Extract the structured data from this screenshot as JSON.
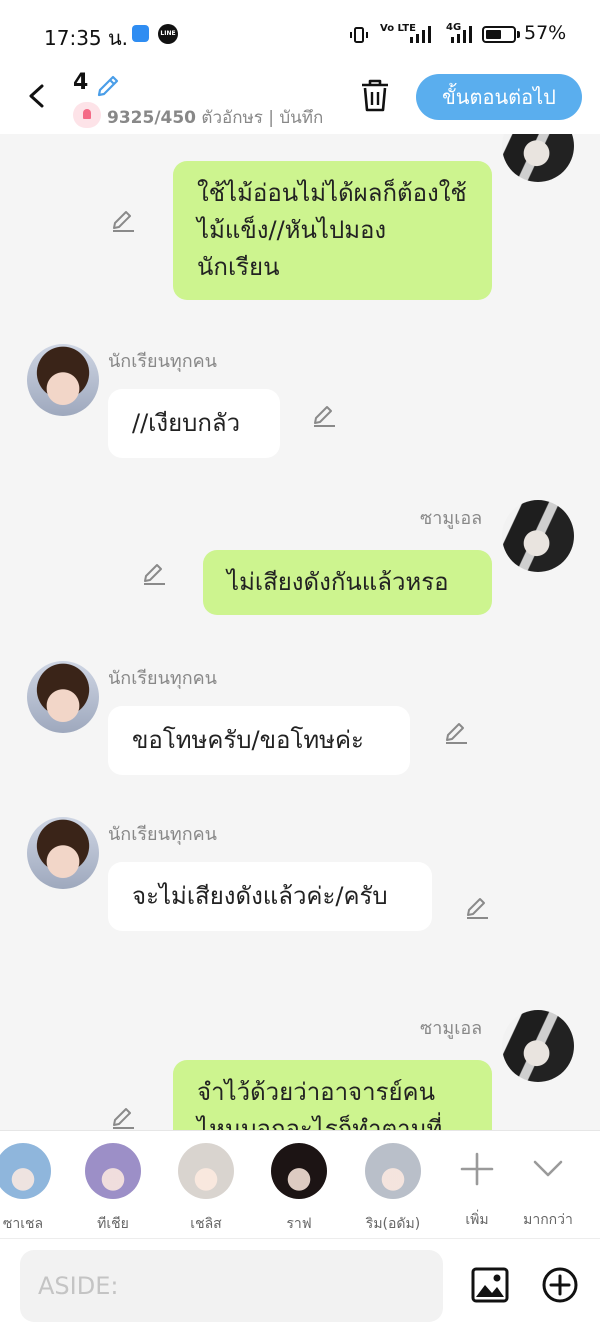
{
  "status_bar": {
    "time": "17:35 น.",
    "line_label": "LINE",
    "volte": "Vo LTE",
    "network": "4G",
    "battery_percent": "57%",
    "battery_level": 0.57
  },
  "header": {
    "episode_number": "4",
    "char_count": "9325/450",
    "char_count_suffix": "ตัวอักษร | บันทึก",
    "next_label": "ขั้นตอนต่อไป"
  },
  "messages": [
    {
      "side": "right",
      "text": "ใช้ไม้อ่อนไม่ได้ผลก็ต้องใช้ไม้แข็ง//หันไปมองนักเรียน"
    },
    {
      "side": "left",
      "name": "นักเรียนทุกคน",
      "text": "//เงียบกลัว"
    },
    {
      "side": "right",
      "name": "ซามูเอล",
      "text": "ไม่เสียงดังกันแล้วหรอ"
    },
    {
      "side": "left",
      "name": "นักเรียนทุกคน",
      "text": "ขอโทษครับ/ขอโทษค่ะ"
    },
    {
      "side": "left",
      "name": "นักเรียนทุกคน",
      "text": "จะไม่เสียงดังแล้วค่ะ/ครับ"
    },
    {
      "side": "right",
      "name": "ซามูเอล",
      "text": "จำไว้ด้วยว่าอาจารย์คนไหนบอกอะไรก็ทำตามที่"
    }
  ],
  "characters": [
    {
      "label": "ซาเชล",
      "color": "#8fb6dc"
    },
    {
      "label": "ทีเชีย",
      "color": "#9c8fc7"
    },
    {
      "label": "เชลิส",
      "color": "#d9d4cf"
    },
    {
      "label": "ราฟ",
      "color": "#1c1414"
    },
    {
      "label": "ริม(อดัม)",
      "color": "#b9bfc9"
    }
  ],
  "tools": {
    "add_label": "เพิ่ม",
    "more_label": "มากกว่า"
  },
  "input": {
    "placeholder": "ASIDE:",
    "value": ""
  },
  "colors": {
    "accent": "#5aaeee",
    "my_bubble": "#cdf48f",
    "their_bubble": "#ffffff",
    "background": "#f5f5f5"
  }
}
